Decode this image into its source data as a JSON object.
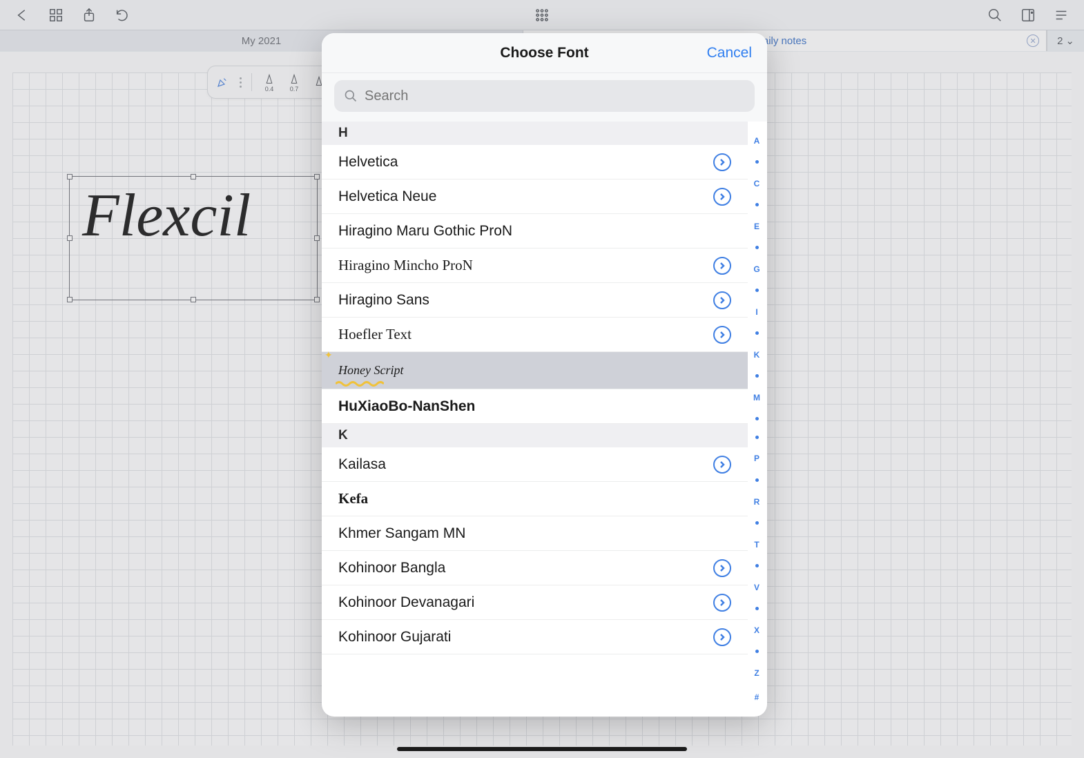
{
  "topbar": {
    "icons": [
      "back",
      "overview",
      "share",
      "undo",
      "apps",
      "search",
      "sidebar",
      "menu"
    ]
  },
  "tabs": {
    "left": "My 2021",
    "right": "aily notes",
    "count": "2"
  },
  "pen_sizes": [
    "0.4",
    "0.7"
  ],
  "textbox_content": "Flexcil",
  "modal": {
    "title": "Choose Font",
    "cancel": "Cancel",
    "search_placeholder": "Search",
    "sections": [
      {
        "letter": "H",
        "fonts": [
          {
            "name": "Helvetica",
            "detail": true
          },
          {
            "name": "Helvetica Neue",
            "detail": true
          },
          {
            "name": "Hiragino Maru Gothic ProN",
            "detail": false
          },
          {
            "name": "Hiragino Mincho ProN",
            "detail": true,
            "style": "mincho"
          },
          {
            "name": "Hiragino Sans",
            "detail": true
          },
          {
            "name": "Hoefler Text",
            "detail": true,
            "style": "hoefler"
          },
          {
            "name": "Honey Script",
            "detail": false,
            "style": "honey",
            "selected": true
          },
          {
            "name": "HuXiaoBo-NanShen",
            "detail": false,
            "style": "huxiao"
          }
        ]
      },
      {
        "letter": "K",
        "fonts": [
          {
            "name": "Kailasa",
            "detail": true
          },
          {
            "name": "Kefa",
            "detail": false,
            "style": "kefa"
          },
          {
            "name": "Khmer Sangam MN",
            "detail": false
          },
          {
            "name": "Kohinoor Bangla",
            "detail": true
          },
          {
            "name": "Kohinoor Devanagari",
            "detail": true
          },
          {
            "name": "Kohinoor Gujarati",
            "detail": true
          }
        ]
      }
    ],
    "index": [
      "A",
      "•",
      "C",
      "•",
      "E",
      "•",
      "G",
      "•",
      "I",
      "•",
      "K",
      "•",
      "M",
      "•",
      "•",
      "P",
      "•",
      "R",
      "•",
      "T",
      "•",
      "V",
      "•",
      "X",
      "•",
      "Z",
      "#"
    ]
  }
}
